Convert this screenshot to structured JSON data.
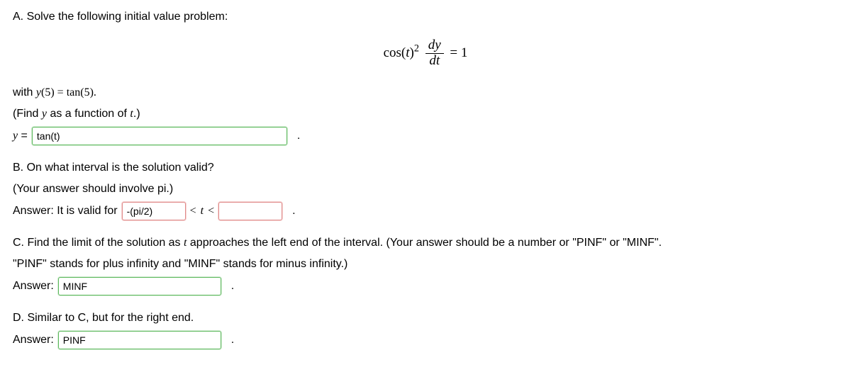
{
  "partA": {
    "prompt": "A. Solve the following initial value problem:",
    "equation": {
      "prefix": "cos(",
      "var_t": "t",
      "close_sq": ")",
      "exp": "2",
      "dy": "dy",
      "dt": "dt",
      "eq": " = 1"
    },
    "condition_prefix": "with ",
    "condition_y": "y",
    "condition_paren": "(5) = tan(5).",
    "instruction_open": "(Find ",
    "instruction_y": "y",
    "instruction_mid": " as a function of ",
    "instruction_t": "t",
    "instruction_close": ".)",
    "answer_label_y": "y",
    "answer_label_eq": " = ",
    "answer_value": "tan(t)"
  },
  "partB": {
    "prompt": "B. On what interval is the solution valid?",
    "hint": "(Your answer should involve pi.)",
    "answer_prefix": "Answer: It is valid for",
    "left_value": "-(pi/2)",
    "lt1": "<",
    "tvar": "t",
    "lt2": "<",
    "right_value": ""
  },
  "partC": {
    "prompt_1": "C. Find the limit of the solution as ",
    "prompt_t": "t",
    "prompt_2": " approaches the left end of the interval. (Your answer should be a number or \"PINF\" or \"MINF\".",
    "prompt_3": "\"PINF\" stands for plus infinity and \"MINF\" stands for minus infinity.)",
    "answer_label": "Answer:",
    "answer_value": "MINF"
  },
  "partD": {
    "prompt": "D. Similar to C, but for the right end.",
    "answer_label": "Answer:",
    "answer_value": "PINF"
  },
  "period": "."
}
